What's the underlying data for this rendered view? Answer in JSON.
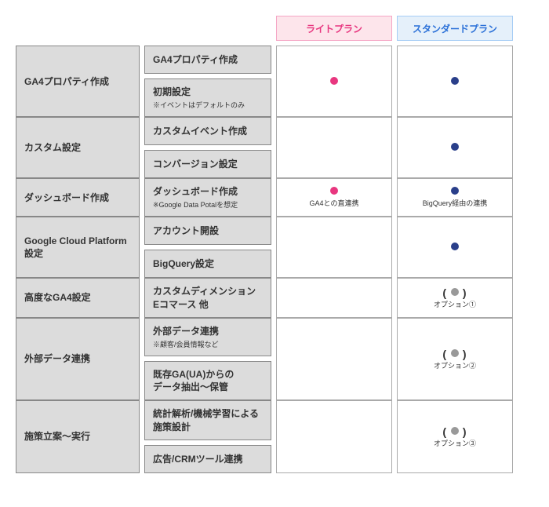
{
  "plans": {
    "light": "ライトプラン",
    "standard": "スタンダードプラン"
  },
  "rows": [
    {
      "category": "GA4プロパティ作成",
      "subs": [
        {
          "title": "GA4プロパティ作成",
          "note": ""
        },
        {
          "title": "初期設定",
          "note": "※イベントはデフォルトのみ"
        }
      ],
      "light": {
        "type": "dot",
        "color": "pink",
        "caption": ""
      },
      "standard": {
        "type": "dot",
        "color": "navy",
        "caption": ""
      }
    },
    {
      "category": "カスタム設定",
      "subs": [
        {
          "title": "カスタムイベント作成",
          "note": ""
        },
        {
          "title": "コンバージョン設定",
          "note": ""
        }
      ],
      "light": {
        "type": "none"
      },
      "standard": {
        "type": "dot",
        "color": "navy",
        "caption": ""
      }
    },
    {
      "category": "ダッシュボード作成",
      "subs": [
        {
          "title": "ダッシュボード作成",
          "note": "※Google Data Potalを想定"
        }
      ],
      "light": {
        "type": "dot",
        "color": "pink",
        "caption": "GA4との直連携"
      },
      "standard": {
        "type": "dot",
        "color": "navy",
        "caption": "BigQuery経由の連携"
      }
    },
    {
      "category": "Google Cloud Platform設定",
      "subs": [
        {
          "title": "アカウント開設",
          "note": ""
        },
        {
          "title": "BigQuery設定",
          "note": ""
        }
      ],
      "light": {
        "type": "none"
      },
      "standard": {
        "type": "dot",
        "color": "navy",
        "caption": ""
      }
    },
    {
      "category": "高度なGA4設定",
      "subs": [
        {
          "title": "カスタムディメンション\nEコマース 他",
          "note": ""
        }
      ],
      "light": {
        "type": "none"
      },
      "standard": {
        "type": "option",
        "label": "オプション①"
      }
    },
    {
      "category": "外部データ連携",
      "subs": [
        {
          "title": "外部データ連携",
          "note": "※顧客/会員情報など"
        },
        {
          "title": "既存GA(UA)からの\nデータ抽出～保管",
          "note": ""
        }
      ],
      "light": {
        "type": "none"
      },
      "standard": {
        "type": "option",
        "label": "オプション②"
      }
    },
    {
      "category": "施策立案～実行",
      "subs": [
        {
          "title": "統計解析/機械学習による\n施策設計",
          "note": ""
        },
        {
          "title": "広告/CRMツール連携",
          "note": ""
        }
      ],
      "light": {
        "type": "none"
      },
      "standard": {
        "type": "option",
        "label": "オプション③"
      }
    }
  ]
}
